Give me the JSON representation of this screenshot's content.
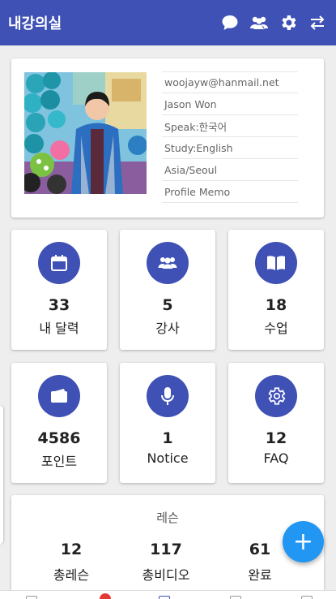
{
  "app": {
    "title": "내강의실",
    "colors": {
      "primary": "#3f51b5",
      "fab": "#2196f3",
      "badge": "#e53935"
    },
    "actions": [
      "chat-icon",
      "group-icon",
      "settings-icon",
      "swap-icon"
    ]
  },
  "profile": {
    "email": "woojayw@hanmail.net",
    "name": "Jason Won",
    "speak": "Speak:한국어",
    "study": "Study:English",
    "timezone": "Asia/Seoul",
    "memo": "Profile Memo"
  },
  "tiles": [
    {
      "icon": "calendar-icon",
      "count": "33",
      "label": "내 달력"
    },
    {
      "icon": "group-icon",
      "count": "5",
      "label": "강사"
    },
    {
      "icon": "book-icon",
      "count": "18",
      "label": "수업"
    },
    {
      "icon": "wallet-icon",
      "count": "4586",
      "label": "포인트"
    },
    {
      "icon": "mic-icon",
      "count": "1",
      "label": "Notice"
    },
    {
      "icon": "gear-icon",
      "count": "12",
      "label": "FAQ"
    }
  ],
  "lessons": {
    "title": "레슨",
    "stats": [
      {
        "value": "12",
        "label": "총레슨"
      },
      {
        "value": "117",
        "label": "총비디오"
      },
      {
        "value": "61",
        "label": "완료"
      }
    ]
  },
  "fab": {
    "label": "+"
  }
}
